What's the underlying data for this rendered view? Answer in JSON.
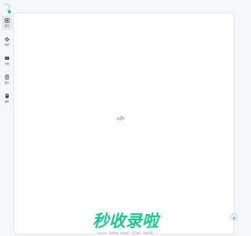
{
  "app": {
    "logo_icon": "app-logo-icon",
    "accent": "#1ec78e"
  },
  "sidebar": {
    "items": [
      {
        "label": "首页",
        "icon": "home-flag-icon",
        "active": true
      },
      {
        "label": "推荐",
        "icon": "compass-icon",
        "active": false
      },
      {
        "label": "视频",
        "icon": "video-icon",
        "active": false
      },
      {
        "label": "图片",
        "icon": "document-icon",
        "active": false
      },
      {
        "label": "福利",
        "icon": "gift-icon",
        "active": false
      }
    ]
  },
  "main": {
    "loading_text": "加载中",
    "brand_text": "秒收录啦",
    "footer_text": "Copyright · 秒收录啦 · 联系我们 · 关于我们 · 网站地图"
  },
  "colors": {
    "background": "#f5f6f8",
    "panel": "#ffffff",
    "brand": "#1ec78e",
    "spinner": "#6b8cff"
  }
}
